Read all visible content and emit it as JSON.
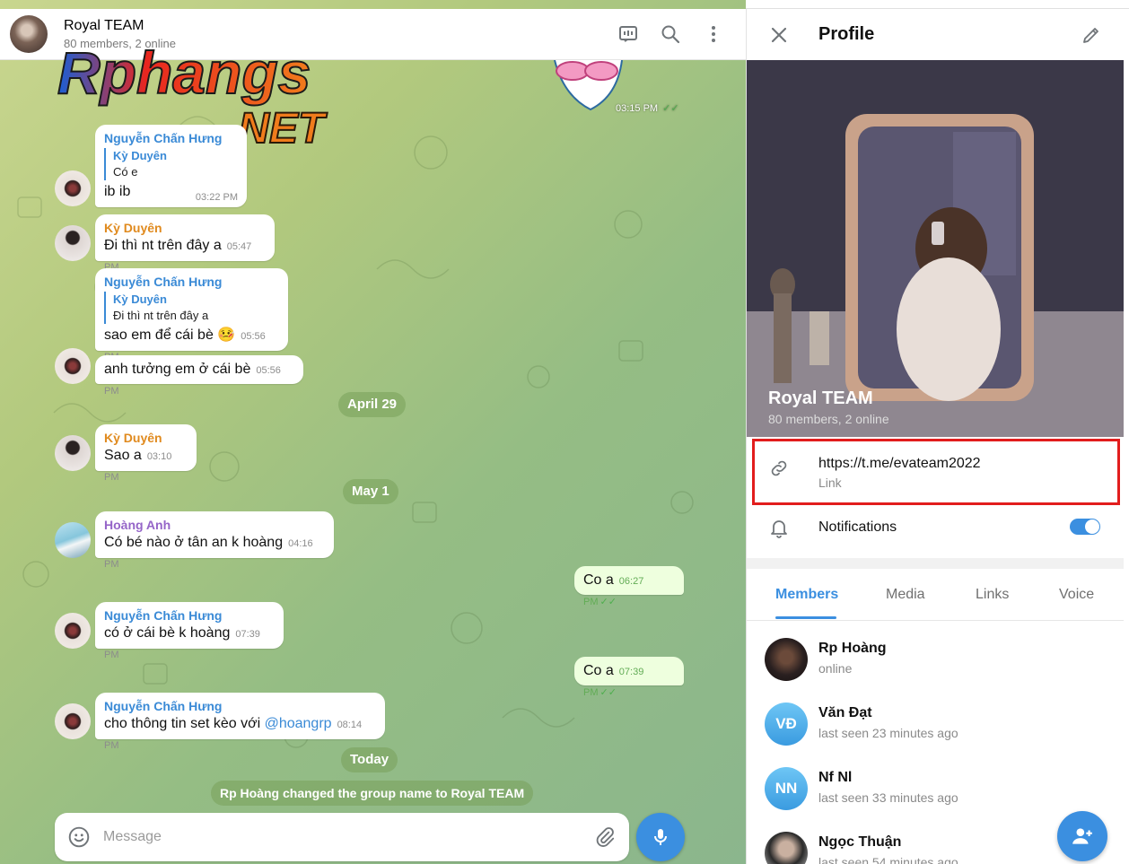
{
  "chat": {
    "title": "Royal TEAM",
    "subtitle": "80 members, 2 online",
    "composer_placeholder": "Message",
    "top_sticker_time": "03:15 PM",
    "messages": [
      {
        "sender": "Nguyễn Chấn Hưng",
        "reply_name": "Kỳ Duyên",
        "reply_text": "Có e",
        "text": "ib ib",
        "time": "03:22 PM"
      },
      {
        "sender": "Kỳ Duyên",
        "text": "Đi thì nt trên đây a",
        "time": "05:47 PM"
      },
      {
        "sender": "Nguyễn Chấn Hưng",
        "reply_name": "Kỳ Duyên",
        "reply_text": "Đi thì nt trên đây a",
        "text": "sao em để cái bè 🤒",
        "time": "05:56 PM"
      },
      {
        "text": "anh tưởng em ở cái bè",
        "time": "05:56 PM"
      },
      {
        "sender": "Kỳ Duyên",
        "text": "Sao a",
        "time": "03:10 PM"
      },
      {
        "sender": "Hoàng Anh",
        "text": "Có bé nào ở tân an k hoàng",
        "time": "04:16 PM"
      },
      {
        "text": "Co a",
        "time": "06:27 PM"
      },
      {
        "sender": "Nguyễn Chấn Hưng",
        "text": "có ở cái bè k hoàng",
        "time": "07:39 PM"
      },
      {
        "text": "Co a",
        "time": "07:39 PM"
      },
      {
        "sender": "Nguyễn Chấn Hưng",
        "text": "cho thông tin set kèo với ",
        "mention": "@hoangrp",
        "time": "08:14 PM"
      }
    ],
    "dates": [
      "April 29",
      "May 1",
      "Today"
    ],
    "service_message": "Rp Hoàng changed the group name to Royal TEAM"
  },
  "watermark": {
    "line1": "Rphangs",
    "line2": ".NET"
  },
  "profile": {
    "header": "Profile",
    "group_name": "Royal TEAM",
    "group_sub": "80 members, 2 online",
    "link": "https://t.me/evateam2022",
    "link_caption": "Link",
    "notifications_label": "Notifications",
    "notifications_on": true,
    "tabs": [
      "Members",
      "Media",
      "Links",
      "Voice"
    ],
    "members": [
      {
        "name": "Rp Hoàng",
        "status": "online",
        "initials": ""
      },
      {
        "name": "Văn Đạt",
        "status": "last seen 23 minutes ago",
        "initials": "VĐ"
      },
      {
        "name": "Nf Nl",
        "status": "last seen 33 minutes ago",
        "initials": "NN"
      },
      {
        "name": "Ngọc Thuận",
        "status": "last seen 54 minutes ago",
        "initials": ""
      }
    ]
  },
  "colors": {
    "accent": "#3b8fe0",
    "highlight_border": "#e21d1d",
    "outgoing_bubble": "#eeffde"
  }
}
